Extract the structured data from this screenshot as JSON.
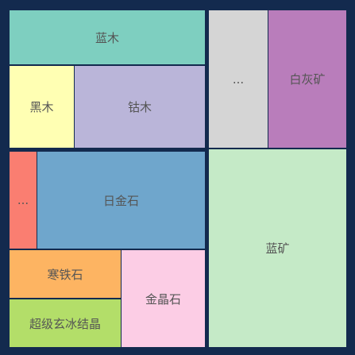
{
  "chart_data": {
    "type": "treemap",
    "items": [
      {
        "key": "lanmu",
        "label": "蓝木",
        "color": "#7ecfc0"
      },
      {
        "key": "heimu",
        "label": "黑木",
        "color": "#ffffb3"
      },
      {
        "key": "gumu",
        "label": "钴木",
        "color": "#bab5d9"
      },
      {
        "key": "small1",
        "label": "...",
        "color": "#d5d5d5"
      },
      {
        "key": "baihuikuang",
        "label": "白灰矿",
        "color": "#b97dbb"
      },
      {
        "key": "small2",
        "label": "...",
        "color": "#fa7e71"
      },
      {
        "key": "rijinshi",
        "label": "日金石",
        "color": "#6fa6cc"
      },
      {
        "key": "lankuang",
        "label": "蓝矿",
        "color": "#c5eac7"
      },
      {
        "key": "hantieshi",
        "label": "寒铁石",
        "color": "#fdb462"
      },
      {
        "key": "chaoji",
        "label": "超级玄冰结晶",
        "color": "#b3de69"
      },
      {
        "key": "jinjingshi",
        "label": "金晶石",
        "color": "#fccde5"
      }
    ]
  }
}
